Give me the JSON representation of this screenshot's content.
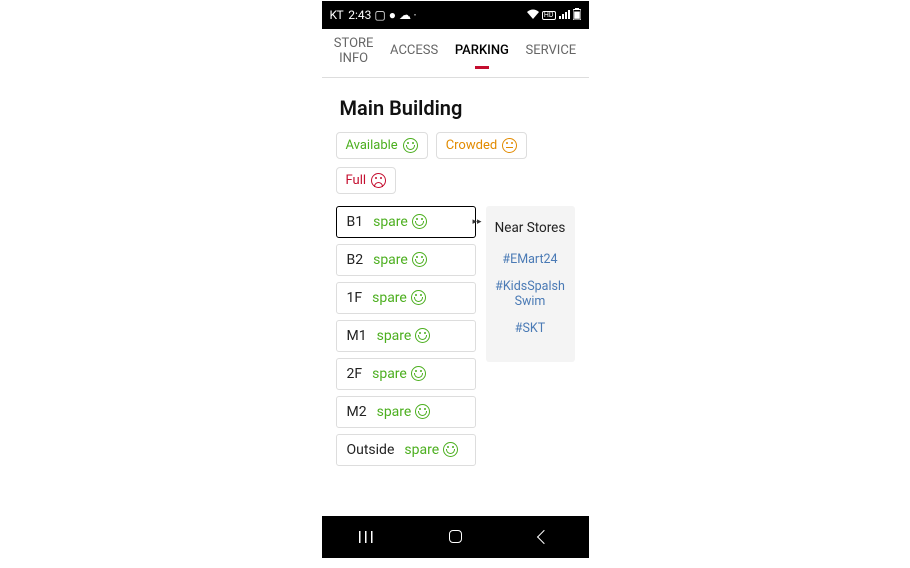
{
  "statusbar": {
    "carrier": "KT",
    "time": "2:43",
    "left_icons": [
      "picture-icon",
      "chat-icon",
      "cloud-icon",
      "dot-icon"
    ],
    "right_icons": [
      "wifi-icon",
      "hd-icon",
      "signal-icon",
      "battery-icon"
    ]
  },
  "tabs": [
    {
      "id": "store-info",
      "label1": "STORE",
      "label2": "INFO",
      "active": false
    },
    {
      "id": "access",
      "label": "ACCESS",
      "active": false
    },
    {
      "id": "parking",
      "label": "PARKING",
      "active": true
    },
    {
      "id": "service",
      "label": "SERVICE",
      "active": false
    }
  ],
  "page_title": "Main Building",
  "legend": {
    "available": "Available",
    "crowded": "Crowded",
    "full": "Full"
  },
  "floors": [
    {
      "name": "B1",
      "status": "spare",
      "selected": true
    },
    {
      "name": "B2",
      "status": "spare",
      "selected": false
    },
    {
      "name": "1F",
      "status": "spare",
      "selected": false
    },
    {
      "name": "M1",
      "status": "spare",
      "selected": false
    },
    {
      "name": "2F",
      "status": "spare",
      "selected": false
    },
    {
      "name": "M2",
      "status": "spare",
      "selected": false
    },
    {
      "name": "Outside",
      "status": "spare",
      "selected": false
    }
  ],
  "near": {
    "title": "Near Stores",
    "links": [
      "#EMart24",
      "#KidsSpalsh Swim",
      "#SKT"
    ]
  },
  "navbar": [
    "recent-apps",
    "home",
    "back"
  ]
}
